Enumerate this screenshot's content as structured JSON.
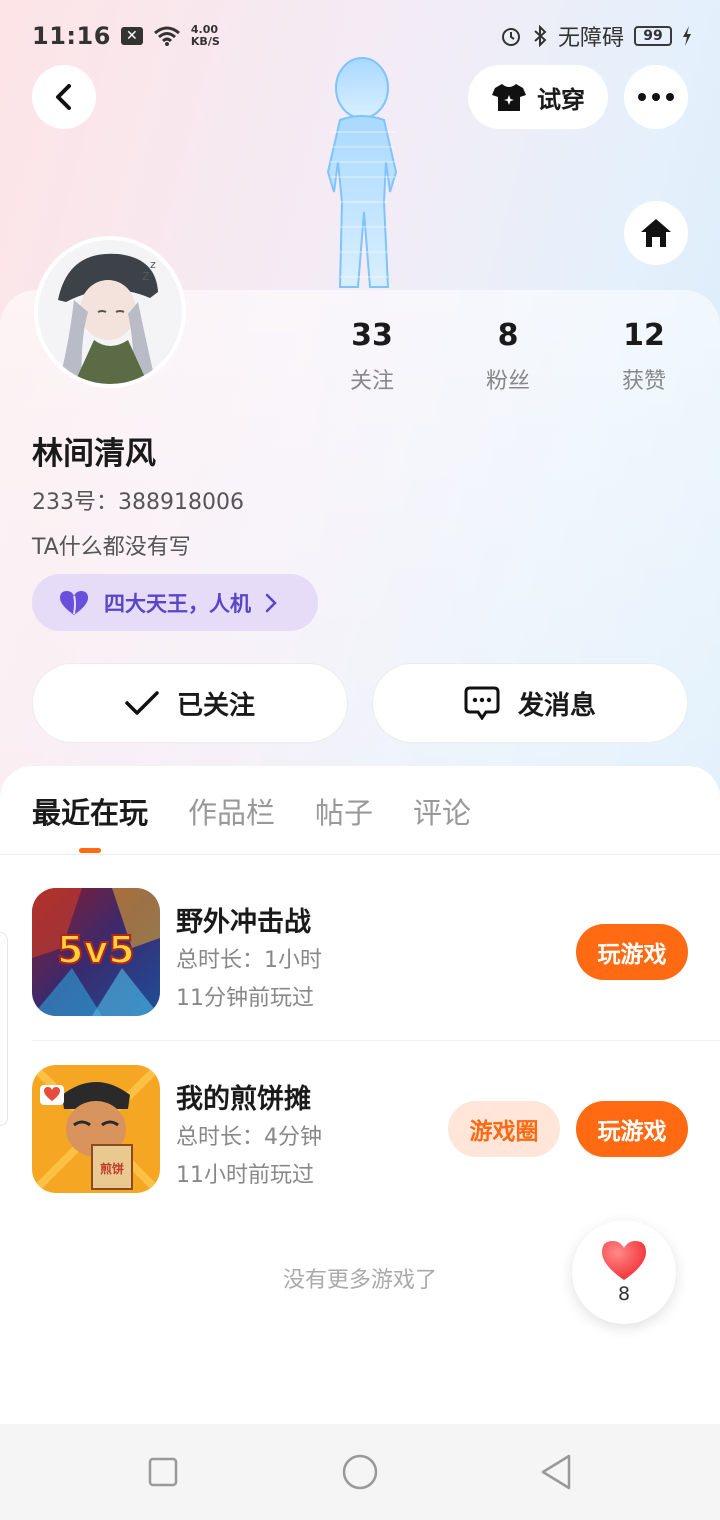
{
  "status_bar": {
    "time": "11:16",
    "net_speed_value": "4.00",
    "net_speed_unit": "KB/S",
    "accessibility": "无障碍",
    "battery": "99"
  },
  "header": {
    "try_on_label": "试穿"
  },
  "profile": {
    "stats": [
      {
        "value": "33",
        "label": "关注"
      },
      {
        "value": "8",
        "label": "粉丝"
      },
      {
        "value": "12",
        "label": "获赞"
      }
    ],
    "name": "林间清风",
    "uid": "233号：388918006",
    "bio": "TA什么都没有写",
    "tag": "四大天王，人机",
    "follow_label": "已关注",
    "message_label": "发消息"
  },
  "tabs": [
    {
      "label": "最近在玩",
      "active": true
    },
    {
      "label": "作品栏",
      "active": false
    },
    {
      "label": "帖子",
      "active": false
    },
    {
      "label": "评论",
      "active": false
    }
  ],
  "games": [
    {
      "title": "野外冲击战",
      "duration": "总时长：1小时",
      "last_played": "11分钟前玩过",
      "play_label": "玩游戏",
      "icon_text": "5v5"
    },
    {
      "title": "我的煎饼摊",
      "duration": "总时长：4分钟",
      "last_played": "11小时前玩过",
      "circle_label": "游戏圈",
      "play_label": "玩游戏",
      "icon_text": "煎饼"
    }
  ],
  "no_more_text": "没有更多游戏了",
  "like_fab": {
    "count": "8"
  },
  "colors": {
    "accent": "#ff6a13",
    "tag_bg": "#e6dcf7",
    "tag_text": "#5a45c8"
  }
}
